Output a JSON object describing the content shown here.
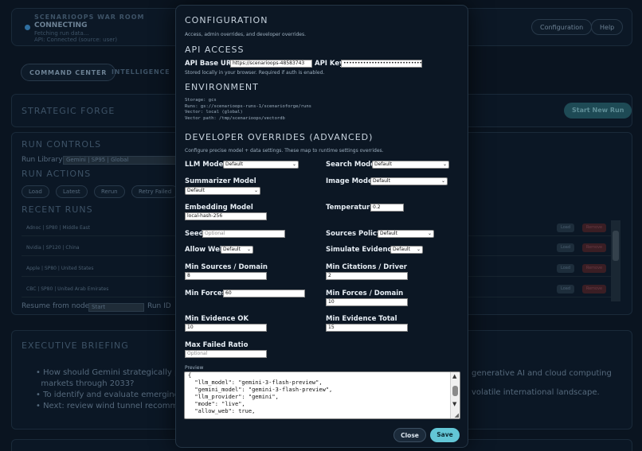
{
  "app": {
    "title": "SCENARIOOPS WAR ROOM",
    "status": "CONNECTING",
    "status_detail": "Fetching run data...",
    "api_status": "API: Connected (source: user)",
    "buttons": {
      "configuration": "Configuration",
      "help": "Help"
    },
    "tabs": {
      "command_center": "COMMAND CENTER",
      "intelligence": "INTELLIGENCE"
    }
  },
  "strategic_forge": {
    "title": "STRATEGIC FORGE",
    "start_run": "Start New Run"
  },
  "run_controls": {
    "title": "RUN CONTROLS",
    "run_library_label": "Run Library",
    "run_library_value": "Gemini | SP95 | Global",
    "actions_title": "RUN ACTIONS",
    "actions": [
      "Load",
      "Latest",
      "Rerun",
      "Retry Failed"
    ],
    "recent_title": "RECENT RUNS",
    "recent_runs": [
      {
        "label": "Adnoc | SP80 | Middle East",
        "load": "Load",
        "remove": "Remove"
      },
      {
        "label": "Nvidia | SP120 | China",
        "load": "Load",
        "remove": "Remove"
      },
      {
        "label": "Apple | SP80 | United States",
        "load": "Load",
        "remove": "Remove"
      },
      {
        "label": "CBC | SP80 | United Arab Emirates",
        "load": "Load",
        "remove": "Remove"
      }
    ],
    "resume_label": "Resume from node",
    "resume_value": "Start",
    "run_id_label": "Run ID"
  },
  "briefing": {
    "title": "EXECUTIVE BRIEFING",
    "bullets": [
      "How should Gemini strategically pos",
      "markets through 2033?",
      "To identify and evaluate emerging g",
      "Next: review wind tunnel recommen"
    ],
    "right_1": "generative AI and cloud computing",
    "right_2": "volatile international landscape."
  },
  "modal": {
    "title": "CONFIGURATION",
    "description": "Access, admin overrides, and developer overrides.",
    "api_access": {
      "title": "API ACCESS",
      "base_url_label": "API Base URL",
      "base_url_value": "https://scenarioops-48583743",
      "api_key_label": "API Key",
      "api_key_value": "••••••••••••••••••••••••••••••••••••••••",
      "note": "Stored locally in your browser. Required if auth is enabled."
    },
    "environment": {
      "title": "ENVIRONMENT",
      "lines": [
        "Storage: gcs",
        "Runs: gs://scenarioops-runs-1/scenarioforge/runs",
        "Vector: local (global)",
        "Vector path: /tmp/scenarioops/vectordb"
      ]
    },
    "dev": {
      "title": "DEVELOPER OVERRIDES (ADVANCED)",
      "description": "Configure precise model + data settings. These map to runtime settings overrides.",
      "llm_model": {
        "label": "LLM Model",
        "value": "Default"
      },
      "search_model": {
        "label": "Search Model",
        "value": "Default"
      },
      "summarizer_model": {
        "label": "Summarizer Model",
        "value": "Default"
      },
      "image_model": {
        "label": "Image Model",
        "value": "Default"
      },
      "embedding_model": {
        "label": "Embedding Model",
        "value": "local-hash-256"
      },
      "temperature": {
        "label": "Temperature",
        "value": "0.2"
      },
      "seed": {
        "label": "Seed",
        "placeholder": "Optional"
      },
      "sources_policy": {
        "label": "Sources Policy",
        "value": "Default"
      },
      "allow_web": {
        "label": "Allow Web",
        "value": "Default"
      },
      "simulate_evidence": {
        "label": "Simulate Evidence",
        "value": "Default"
      },
      "min_sources_domain": {
        "label": "Min Sources / Domain",
        "value": "8"
      },
      "min_citations_driver": {
        "label": "Min Citations / Driver",
        "value": "2"
      },
      "min_forces": {
        "label": "Min Forces",
        "value": "60"
      },
      "min_forces_domain": {
        "label": "Min Forces / Domain",
        "value": "10"
      },
      "min_evidence_ok": {
        "label": "Min Evidence OK",
        "value": "10"
      },
      "min_evidence_total": {
        "label": "Min Evidence Total",
        "value": "15"
      },
      "max_failed_ratio": {
        "label": "Max Failed Ratio",
        "placeholder": "Optional"
      }
    },
    "preview": {
      "label": "Preview",
      "lines": [
        "{",
        "  \"llm_model\": \"gemini-3-flash-preview\",",
        "  \"gemini_model\": \"gemini-3-flash-preview\",",
        "  \"llm_provider\": \"gemini\",",
        "  \"mode\": \"live\",",
        "  \"allow_web\": true,"
      ]
    },
    "close": "Close",
    "save": "Save"
  }
}
